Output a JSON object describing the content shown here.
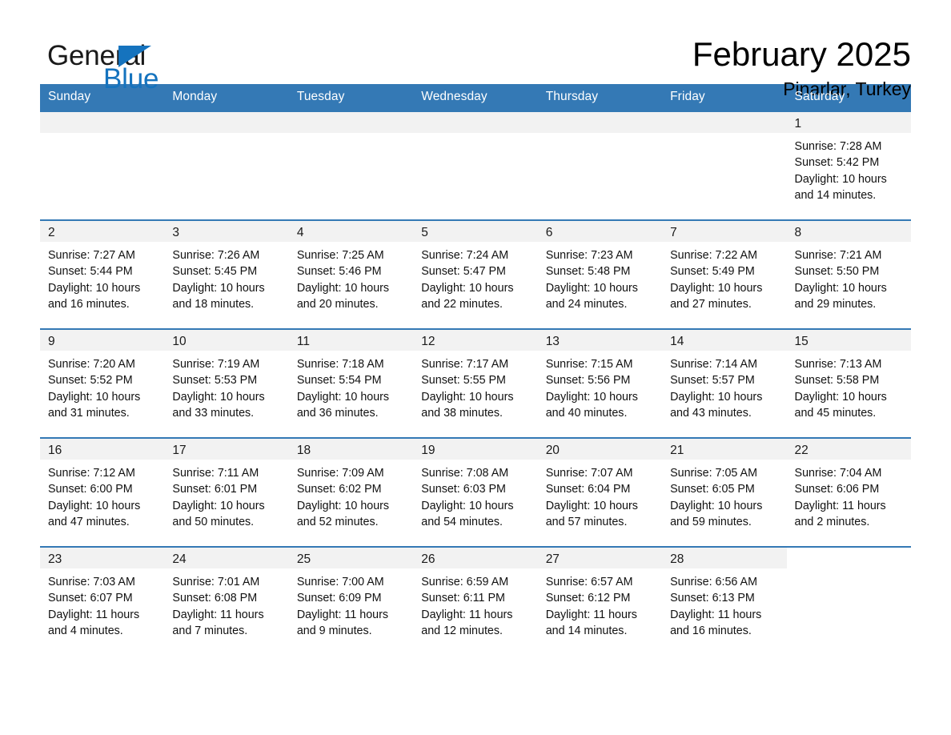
{
  "brand": {
    "name_part1": "General",
    "name_part2": "Blue",
    "triangle_icon": "triangle-icon",
    "accent_color": "#1573be"
  },
  "header": {
    "title": "February 2025",
    "subtitle": "Pinarlar, Turkey"
  },
  "calendar": {
    "header_bg": "#3479b5",
    "daynum_bg": "#f2f2f2",
    "weekday_headers": [
      "Sunday",
      "Monday",
      "Tuesday",
      "Wednesday",
      "Thursday",
      "Friday",
      "Saturday"
    ],
    "labels": {
      "sunrise": "Sunrise:",
      "sunset": "Sunset:",
      "daylight": "Daylight:"
    },
    "weeks": [
      [
        null,
        null,
        null,
        null,
        null,
        null,
        {
          "day": "1",
          "sunrise": "Sunrise: 7:28 AM",
          "sunset": "Sunset: 5:42 PM",
          "daylight_line1": "Daylight: 10 hours",
          "daylight_line2": "and 14 minutes."
        }
      ],
      [
        {
          "day": "2",
          "sunrise": "Sunrise: 7:27 AM",
          "sunset": "Sunset: 5:44 PM",
          "daylight_line1": "Daylight: 10 hours",
          "daylight_line2": "and 16 minutes."
        },
        {
          "day": "3",
          "sunrise": "Sunrise: 7:26 AM",
          "sunset": "Sunset: 5:45 PM",
          "daylight_line1": "Daylight: 10 hours",
          "daylight_line2": "and 18 minutes."
        },
        {
          "day": "4",
          "sunrise": "Sunrise: 7:25 AM",
          "sunset": "Sunset: 5:46 PM",
          "daylight_line1": "Daylight: 10 hours",
          "daylight_line2": "and 20 minutes."
        },
        {
          "day": "5",
          "sunrise": "Sunrise: 7:24 AM",
          "sunset": "Sunset: 5:47 PM",
          "daylight_line1": "Daylight: 10 hours",
          "daylight_line2": "and 22 minutes."
        },
        {
          "day": "6",
          "sunrise": "Sunrise: 7:23 AM",
          "sunset": "Sunset: 5:48 PM",
          "daylight_line1": "Daylight: 10 hours",
          "daylight_line2": "and 24 minutes."
        },
        {
          "day": "7",
          "sunrise": "Sunrise: 7:22 AM",
          "sunset": "Sunset: 5:49 PM",
          "daylight_line1": "Daylight: 10 hours",
          "daylight_line2": "and 27 minutes."
        },
        {
          "day": "8",
          "sunrise": "Sunrise: 7:21 AM",
          "sunset": "Sunset: 5:50 PM",
          "daylight_line1": "Daylight: 10 hours",
          "daylight_line2": "and 29 minutes."
        }
      ],
      [
        {
          "day": "9",
          "sunrise": "Sunrise: 7:20 AM",
          "sunset": "Sunset: 5:52 PM",
          "daylight_line1": "Daylight: 10 hours",
          "daylight_line2": "and 31 minutes."
        },
        {
          "day": "10",
          "sunrise": "Sunrise: 7:19 AM",
          "sunset": "Sunset: 5:53 PM",
          "daylight_line1": "Daylight: 10 hours",
          "daylight_line2": "and 33 minutes."
        },
        {
          "day": "11",
          "sunrise": "Sunrise: 7:18 AM",
          "sunset": "Sunset: 5:54 PM",
          "daylight_line1": "Daylight: 10 hours",
          "daylight_line2": "and 36 minutes."
        },
        {
          "day": "12",
          "sunrise": "Sunrise: 7:17 AM",
          "sunset": "Sunset: 5:55 PM",
          "daylight_line1": "Daylight: 10 hours",
          "daylight_line2": "and 38 minutes."
        },
        {
          "day": "13",
          "sunrise": "Sunrise: 7:15 AM",
          "sunset": "Sunset: 5:56 PM",
          "daylight_line1": "Daylight: 10 hours",
          "daylight_line2": "and 40 minutes."
        },
        {
          "day": "14",
          "sunrise": "Sunrise: 7:14 AM",
          "sunset": "Sunset: 5:57 PM",
          "daylight_line1": "Daylight: 10 hours",
          "daylight_line2": "and 43 minutes."
        },
        {
          "day": "15",
          "sunrise": "Sunrise: 7:13 AM",
          "sunset": "Sunset: 5:58 PM",
          "daylight_line1": "Daylight: 10 hours",
          "daylight_line2": "and 45 minutes."
        }
      ],
      [
        {
          "day": "16",
          "sunrise": "Sunrise: 7:12 AM",
          "sunset": "Sunset: 6:00 PM",
          "daylight_line1": "Daylight: 10 hours",
          "daylight_line2": "and 47 minutes."
        },
        {
          "day": "17",
          "sunrise": "Sunrise: 7:11 AM",
          "sunset": "Sunset: 6:01 PM",
          "daylight_line1": "Daylight: 10 hours",
          "daylight_line2": "and 50 minutes."
        },
        {
          "day": "18",
          "sunrise": "Sunrise: 7:09 AM",
          "sunset": "Sunset: 6:02 PM",
          "daylight_line1": "Daylight: 10 hours",
          "daylight_line2": "and 52 minutes."
        },
        {
          "day": "19",
          "sunrise": "Sunrise: 7:08 AM",
          "sunset": "Sunset: 6:03 PM",
          "daylight_line1": "Daylight: 10 hours",
          "daylight_line2": "and 54 minutes."
        },
        {
          "day": "20",
          "sunrise": "Sunrise: 7:07 AM",
          "sunset": "Sunset: 6:04 PM",
          "daylight_line1": "Daylight: 10 hours",
          "daylight_line2": "and 57 minutes."
        },
        {
          "day": "21",
          "sunrise": "Sunrise: 7:05 AM",
          "sunset": "Sunset: 6:05 PM",
          "daylight_line1": "Daylight: 10 hours",
          "daylight_line2": "and 59 minutes."
        },
        {
          "day": "22",
          "sunrise": "Sunrise: 7:04 AM",
          "sunset": "Sunset: 6:06 PM",
          "daylight_line1": "Daylight: 11 hours",
          "daylight_line2": "and 2 minutes."
        }
      ],
      [
        {
          "day": "23",
          "sunrise": "Sunrise: 7:03 AM",
          "sunset": "Sunset: 6:07 PM",
          "daylight_line1": "Daylight: 11 hours",
          "daylight_line2": "and 4 minutes."
        },
        {
          "day": "24",
          "sunrise": "Sunrise: 7:01 AM",
          "sunset": "Sunset: 6:08 PM",
          "daylight_line1": "Daylight: 11 hours",
          "daylight_line2": "and 7 minutes."
        },
        {
          "day": "25",
          "sunrise": "Sunrise: 7:00 AM",
          "sunset": "Sunset: 6:09 PM",
          "daylight_line1": "Daylight: 11 hours",
          "daylight_line2": "and 9 minutes."
        },
        {
          "day": "26",
          "sunrise": "Sunrise: 6:59 AM",
          "sunset": "Sunset: 6:11 PM",
          "daylight_line1": "Daylight: 11 hours",
          "daylight_line2": "and 12 minutes."
        },
        {
          "day": "27",
          "sunrise": "Sunrise: 6:57 AM",
          "sunset": "Sunset: 6:12 PM",
          "daylight_line1": "Daylight: 11 hours",
          "daylight_line2": "and 14 minutes."
        },
        {
          "day": "28",
          "sunrise": "Sunrise: 6:56 AM",
          "sunset": "Sunset: 6:13 PM",
          "daylight_line1": "Daylight: 11 hours",
          "daylight_line2": "and 16 minutes."
        },
        null
      ]
    ]
  }
}
